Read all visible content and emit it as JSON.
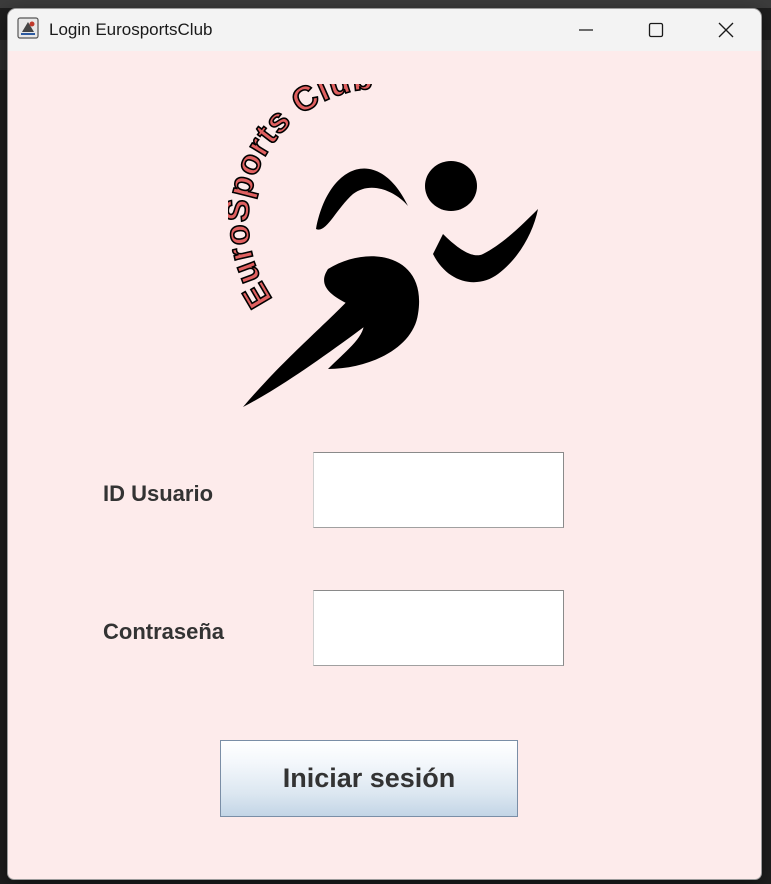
{
  "window": {
    "title": "Login EurosportsClub"
  },
  "logo": {
    "text": "EuroSports Club"
  },
  "form": {
    "user_label": "ID Usuario",
    "user_value": "",
    "password_label": "Contraseña",
    "password_value": ""
  },
  "actions": {
    "login_label": "Iniciar sesión"
  },
  "colors": {
    "window_bg": "#fdebeb",
    "logo_text_fill": "#e06060",
    "runner": "#000000"
  }
}
